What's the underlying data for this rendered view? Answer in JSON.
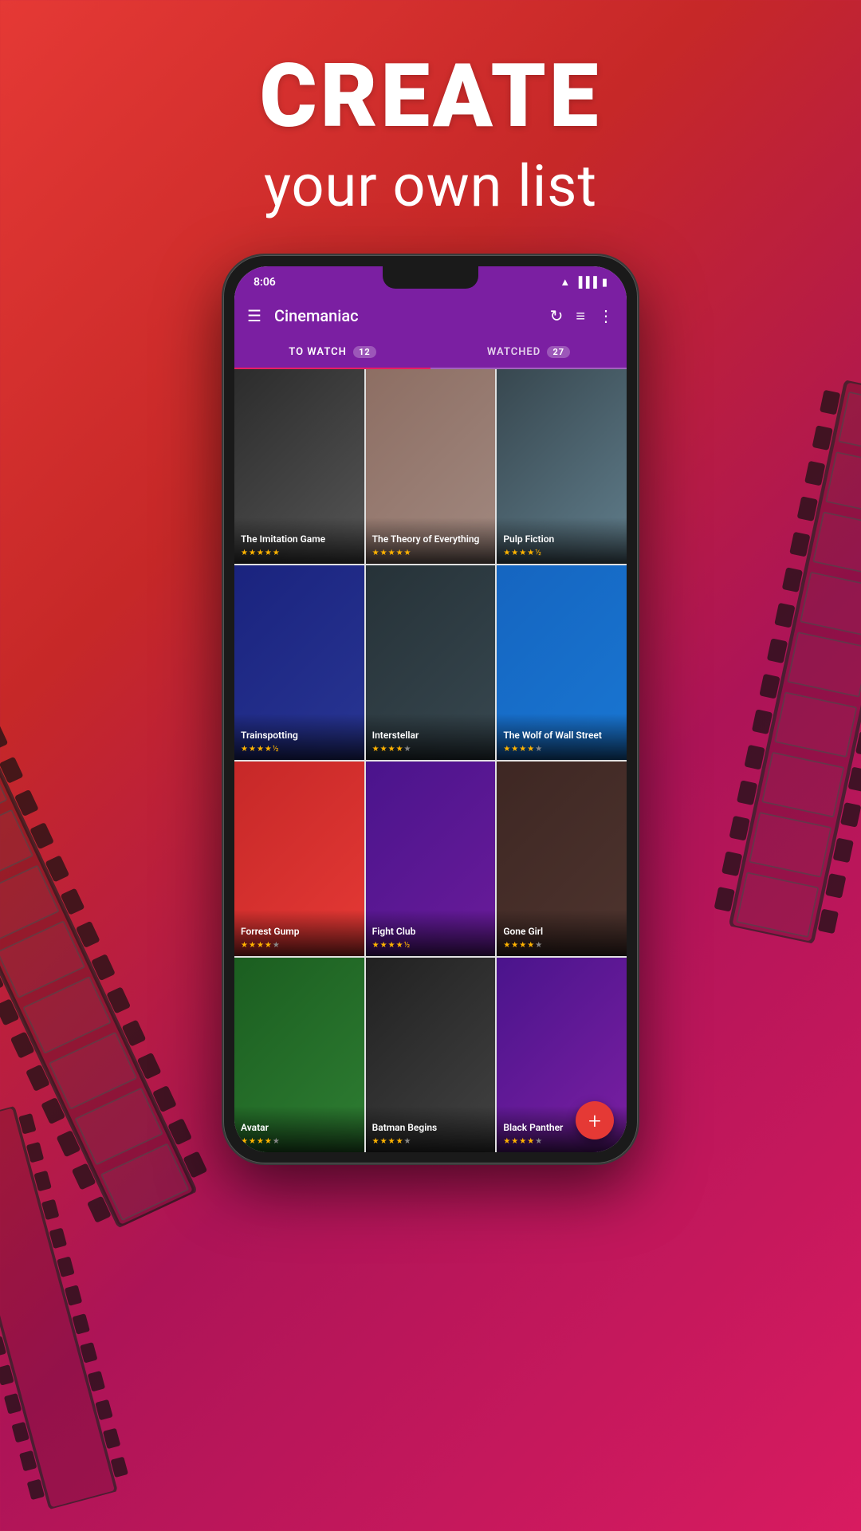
{
  "hero": {
    "create_label": "CREATE",
    "subtitle_label": "your own list"
  },
  "status_bar": {
    "time": "8:06",
    "wifi_icon": "wifi",
    "signal_icon": "signal",
    "battery_icon": "battery"
  },
  "app_bar": {
    "menu_icon": "☰",
    "title": "Cinemaniac",
    "refresh_icon": "↻",
    "list_icon": "≡",
    "more_icon": "⋮"
  },
  "tabs": [
    {
      "label": "TO WATCH",
      "badge": "12",
      "active": true
    },
    {
      "label": "WATCHED",
      "badge": "27",
      "active": false
    }
  ],
  "movies": [
    {
      "title": "The Imitation Game",
      "stars": [
        1,
        1,
        1,
        1,
        1
      ],
      "poster_class": "poster-imitation",
      "rating": 5
    },
    {
      "title": "The Theory of Everything",
      "stars": [
        1,
        1,
        1,
        1,
        1
      ],
      "poster_class": "poster-theory",
      "rating": 5
    },
    {
      "title": "Pulp Fiction",
      "stars": [
        1,
        1,
        1,
        1,
        0.5
      ],
      "poster_class": "poster-pulp",
      "rating": 4.5
    },
    {
      "title": "Trainspotting",
      "stars": [
        1,
        1,
        1,
        1,
        0.5
      ],
      "poster_class": "poster-trainspotting",
      "rating": 4.5
    },
    {
      "title": "Interstellar",
      "stars": [
        1,
        1,
        1,
        1,
        0
      ],
      "poster_class": "poster-interstellar",
      "rating": 4
    },
    {
      "title": "The Wolf of Wall Street",
      "stars": [
        1,
        1,
        1,
        1,
        0
      ],
      "poster_class": "poster-wolf",
      "rating": 4
    },
    {
      "title": "Forrest Gump",
      "stars": [
        1,
        1,
        1,
        1,
        0
      ],
      "poster_class": "poster-forrest",
      "rating": 4
    },
    {
      "title": "Fight Club",
      "stars": [
        1,
        1,
        1,
        1,
        0.5
      ],
      "poster_class": "poster-fight",
      "rating": 4.5
    },
    {
      "title": "Gone Girl",
      "stars": [
        1,
        1,
        1,
        1,
        0
      ],
      "poster_class": "poster-gonegirl",
      "rating": 4
    },
    {
      "title": "Avatar",
      "stars": [
        1,
        1,
        1,
        1,
        0
      ],
      "poster_class": "poster-avatar",
      "rating": 4
    },
    {
      "title": "Batman Begins",
      "stars": [
        1,
        1,
        1,
        1,
        0
      ],
      "poster_class": "poster-batman",
      "rating": 4
    },
    {
      "title": "Black Panther",
      "stars": [
        1,
        1,
        1,
        1,
        0
      ],
      "poster_class": "poster-panther",
      "rating": 4
    }
  ],
  "fab": {
    "icon": "+"
  }
}
